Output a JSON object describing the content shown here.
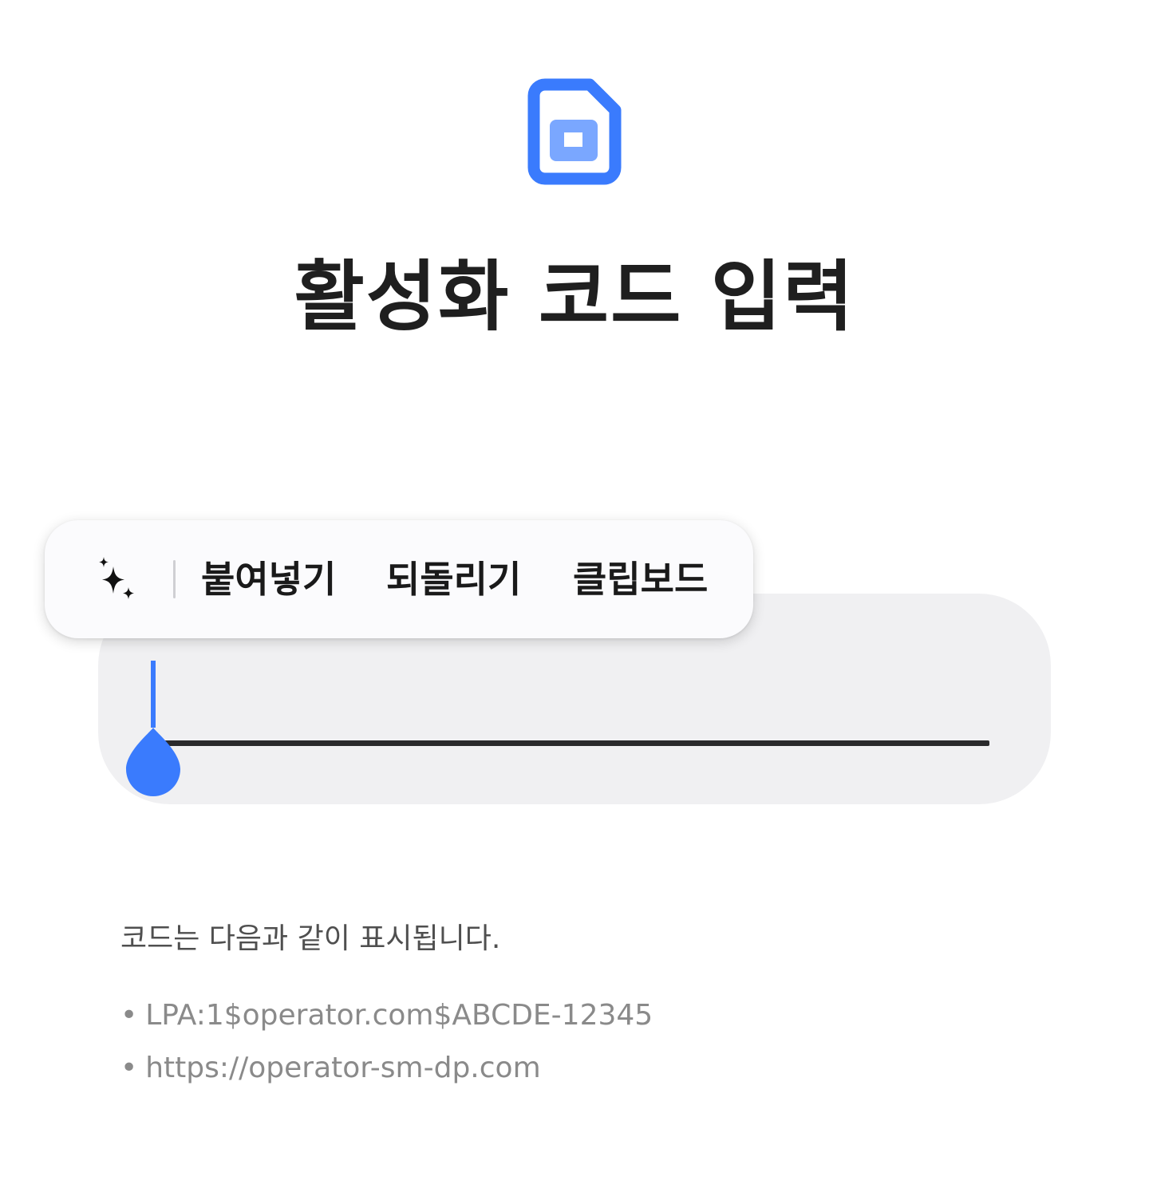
{
  "header": {
    "icon": "esim-card-icon",
    "title": "활성화 코드 입력"
  },
  "colors": {
    "accent": "#3a7bfd",
    "accent_light": "#7aa7ff",
    "field_background": "#f0f0f2",
    "title": "#1f1f1f",
    "muted_text": "#8a8a8a"
  },
  "context_menu": {
    "ai_icon": "sparkles-icon",
    "paste_label": "붙여넣기",
    "undo_label": "되돌리기",
    "clipboard_label": "클립보드"
  },
  "code_input": {
    "value": ""
  },
  "help": {
    "description": "코드는 다음과 같이 표시됩니다.",
    "bullet_symbol": "•",
    "examples": [
      "LPA:1$operator.com$ABCDE-12345",
      "https://operator-sm-dp.com"
    ]
  }
}
